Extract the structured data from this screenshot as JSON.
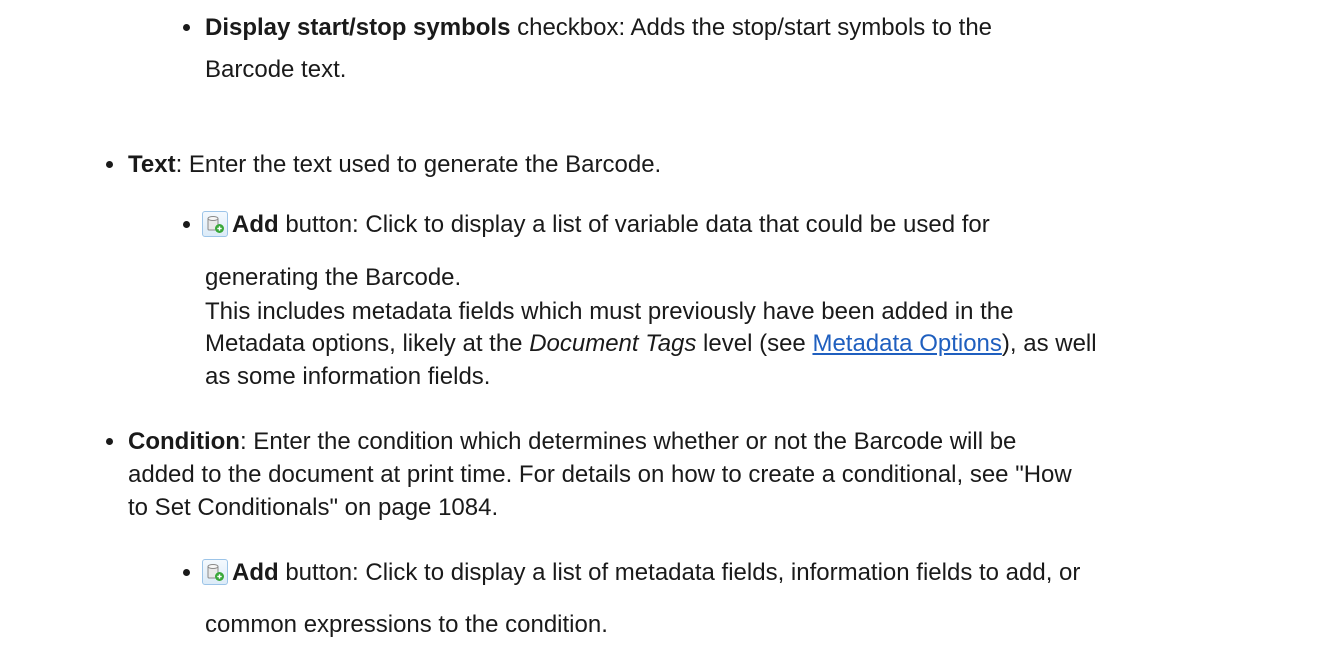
{
  "display_start_stop": {
    "label": "Display start/stop symbols",
    "text_1": " checkbox: Adds the stop/start symbols to the",
    "text_2": "Barcode text."
  },
  "text_item": {
    "label": "Text",
    "desc": ": Enter the text used to generate the Barcode."
  },
  "text_add": {
    "icon": "add-database-icon",
    "label": "Add",
    "text_1": " button: Click to display a list of variable data that could be used for",
    "text_2": "generating the Barcode.",
    "text_3": "This includes metadata fields which must previously have been added in the",
    "text_4a": "Metadata options, likely at the ",
    "text_4_italic": "Document Tags",
    "text_4b": " level (see ",
    "link": "Metadata Options",
    "text_4c": "), as well",
    "text_5": "as some information fields."
  },
  "condition_item": {
    "label": "Condition",
    "text_1": ": Enter the condition which determines whether or not the Barcode will be",
    "text_2": "added to the document at print time. For details on how to create a conditional, see \"How",
    "text_3": "to Set Conditionals\" on page 1084."
  },
  "condition_add": {
    "icon": "add-database-icon",
    "label": "Add",
    "text_1": " button: Click to display a list of metadata fields, information fields to add, or",
    "text_2": "common expressions to the condition."
  },
  "colors": {
    "text": "#1a1a1a",
    "link": "#1f5fbf",
    "icon_border": "#9cc4e8",
    "icon_plus": "#3aa83a"
  }
}
